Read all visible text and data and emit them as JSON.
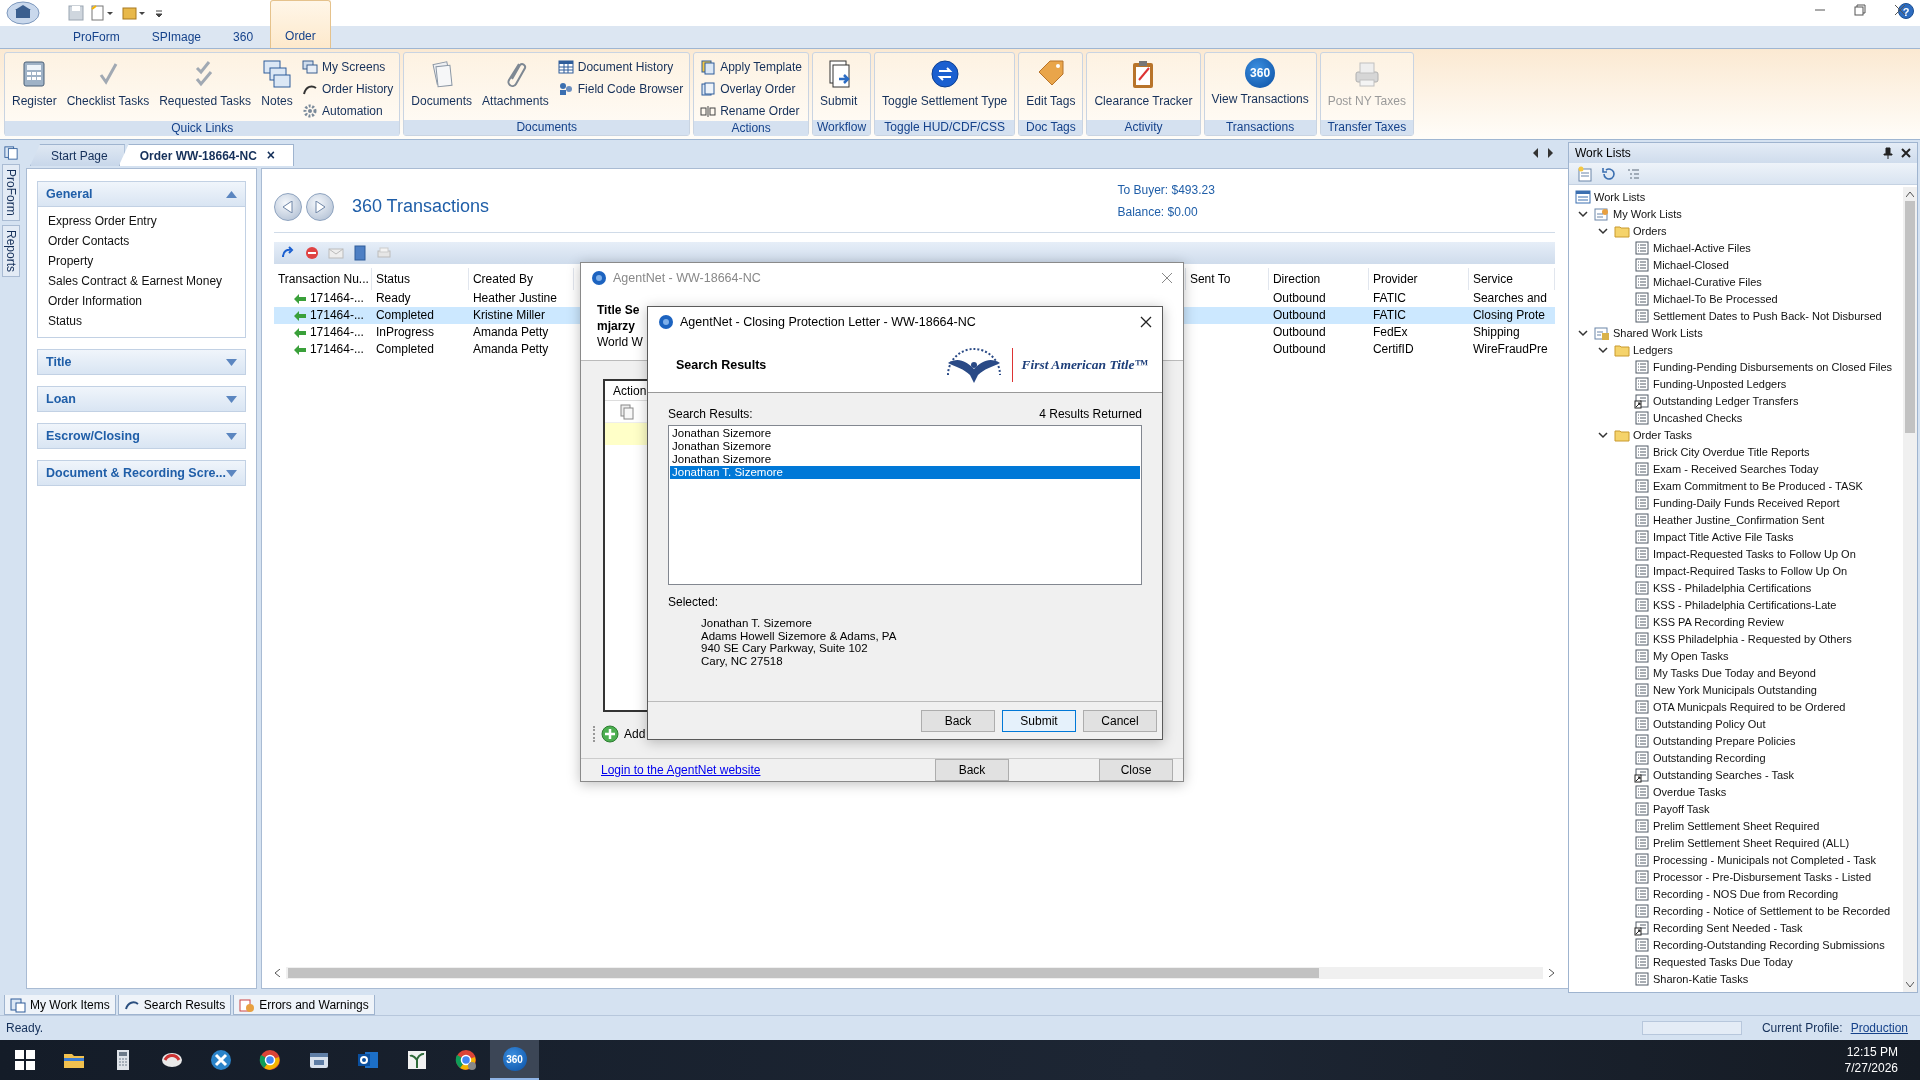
{
  "ribbon_tabs": [
    {
      "label": "ProForm",
      "selected": false
    },
    {
      "label": "SPImage",
      "selected": false
    },
    {
      "label": "360",
      "selected": false
    },
    {
      "label": "Order",
      "selected": true
    }
  ],
  "help": "?",
  "ribbon_groups": [
    {
      "label": "Quick Links",
      "buttons": [
        {
          "label": "Register",
          "kind": "large"
        },
        {
          "label": "Checklist Tasks",
          "kind": "large"
        },
        {
          "label": "Requested Tasks",
          "kind": "large"
        },
        {
          "label": "Notes",
          "kind": "large"
        },
        {
          "label": "My Screens",
          "kind": "small"
        },
        {
          "label": "Order History",
          "kind": "small"
        },
        {
          "label": "Automation",
          "kind": "small"
        }
      ]
    },
    {
      "label": "Documents",
      "buttons": [
        {
          "label": "Documents",
          "kind": "large"
        },
        {
          "label": "Attachments",
          "kind": "large"
        },
        {
          "label": "Document History",
          "kind": "small"
        },
        {
          "label": "Field Code Browser",
          "kind": "small"
        }
      ]
    },
    {
      "label": "Actions",
      "buttons": [
        {
          "label": "Apply Template",
          "kind": "small"
        },
        {
          "label": "Overlay Order",
          "kind": "small"
        },
        {
          "label": "Rename Order",
          "kind": "small"
        }
      ]
    },
    {
      "label": "Workflow",
      "buttons": [
        {
          "label": "Submit",
          "kind": "large"
        }
      ]
    },
    {
      "label": "Toggle HUD/CDF/CSS",
      "buttons": [
        {
          "label": "Toggle Settlement Type",
          "kind": "large"
        }
      ]
    },
    {
      "label": "Doc Tags",
      "buttons": [
        {
          "label": "Edit Tags",
          "kind": "large"
        }
      ]
    },
    {
      "label": "Activity",
      "buttons": [
        {
          "label": "Clearance Tracker",
          "kind": "large"
        }
      ]
    },
    {
      "label": "Transactions",
      "buttons": [
        {
          "label": "View Transactions",
          "kind": "large",
          "badge": "360"
        }
      ]
    },
    {
      "label": "Transfer Taxes",
      "buttons": [
        {
          "label": "Post NY Taxes",
          "kind": "large",
          "disabled": true
        }
      ]
    }
  ],
  "side_tabs": [
    "ProForm",
    "Reports"
  ],
  "document_tabs": [
    {
      "label": "Start Page",
      "selected": false
    },
    {
      "label": "Order WW-18664-NC",
      "selected": true,
      "close": "×"
    }
  ],
  "nav_sections": [
    {
      "title": "General",
      "expanded": true,
      "items": [
        "Express Order Entry",
        "Order Contacts",
        "Property",
        "Sales Contract & Earnest Money",
        "Order Information",
        "Status"
      ]
    },
    {
      "title": "Title",
      "expanded": false
    },
    {
      "title": "Loan",
      "expanded": false
    },
    {
      "title": "Escrow/Closing",
      "expanded": false
    },
    {
      "title": "Document & Recording Scre...",
      "expanded": false
    }
  ],
  "transactions": {
    "title": "360 Transactions",
    "to_buyer": "To Buyer: $493.23",
    "balance": "Balance: $0.00",
    "columns": [
      "Transaction Nu...",
      "Status",
      "Created By",
      "Sent To",
      "Direction",
      "Provider",
      "Service"
    ],
    "rows": [
      {
        "selected": false,
        "cells": [
          "171464-...",
          "Ready",
          "Heather Justine",
          "",
          "Outbound",
          "FATIC",
          "Searches and"
        ]
      },
      {
        "selected": true,
        "cells": [
          "171464-...",
          "Completed",
          "Kristine Miller",
          "",
          "Outbound",
          "FATIC",
          "Closing Prote"
        ]
      },
      {
        "selected": false,
        "cells": [
          "171464-...",
          "InProgress",
          "Amanda Petty",
          "",
          "Outbound",
          "FedEx",
          "Shipping"
        ]
      },
      {
        "selected": false,
        "cells": [
          "171464-...",
          "Completed",
          "Amanda Petty",
          "",
          "Outbound",
          "CertifID",
          "WireFraudPre"
        ]
      }
    ]
  },
  "agentnet_dialog": {
    "title": "AgentNet - WW-18664-NC",
    "header_lines": [
      "Title Se",
      "mjarzy",
      "World W"
    ],
    "table_header": "Action",
    "add_label": "Add",
    "link": "Login to the AgentNet website",
    "buttons": [
      "Back",
      "Close"
    ]
  },
  "cpl_dialog": {
    "title": "AgentNet - Closing Protection Letter - WW-18664-NC",
    "heading": "Search Results",
    "logo_text": "First American Title™",
    "results_label": "Search Results:",
    "results_count": "4 Results Returned",
    "results": [
      {
        "name": "Jonathan Sizemore",
        "selected": false
      },
      {
        "name": "Jonathan Sizemore",
        "selected": false
      },
      {
        "name": "Jonathan Sizemore",
        "selected": false
      },
      {
        "name": "Jonathan T. Sizemore",
        "selected": true
      }
    ],
    "selected_label": "Selected:",
    "selected_lines": [
      "Jonathan T. Sizemore",
      "Adams Howell Sizemore & Adams, PA",
      "940 SE Cary Parkway, Suite 102",
      "Cary, NC  27518"
    ],
    "buttons": [
      {
        "label": "Back",
        "default": false
      },
      {
        "label": "Submit",
        "default": true
      },
      {
        "label": "Cancel",
        "default": false
      }
    ]
  },
  "work_lists": {
    "title": "Work Lists",
    "tree": [
      {
        "label": "Work Lists",
        "kind": "root",
        "children": [
          {
            "label": "My Work Lists",
            "kind": "mine",
            "expanded": true,
            "children": [
              {
                "label": "Orders",
                "kind": "folder",
                "expanded": true,
                "children": [
                  {
                    "label": "Michael-Active Files",
                    "kind": "list"
                  },
                  {
                    "label": "Michael-Closed",
                    "kind": "list"
                  },
                  {
                    "label": "Michael-Curative Files",
                    "kind": "list"
                  },
                  {
                    "label": "Michael-To Be Processed",
                    "kind": "list"
                  },
                  {
                    "label": "Settlement Dates to Push Back- Not Disbursed",
                    "kind": "list"
                  }
                ]
              }
            ]
          },
          {
            "label": "Shared Work Lists",
            "kind": "shared",
            "expanded": true,
            "children": [
              {
                "label": "Ledgers",
                "kind": "folder",
                "expanded": true,
                "children": [
                  {
                    "label": "Funding-Pending Disbursements on Closed Files",
                    "kind": "list"
                  },
                  {
                    "label": "Funding-Unposted Ledgers",
                    "kind": "list"
                  },
                  {
                    "label": "Outstanding Ledger Transfers",
                    "kind": "link"
                  },
                  {
                    "label": "Uncashed Checks",
                    "kind": "list"
                  }
                ]
              },
              {
                "label": "Order Tasks",
                "kind": "folder",
                "expanded": true,
                "children": [
                  {
                    "label": "Brick City Overdue Title Reports",
                    "kind": "list"
                  },
                  {
                    "label": "Exam - Received Searches Today",
                    "kind": "list"
                  },
                  {
                    "label": "Exam Commitment to Be Produced - TASK",
                    "kind": "list"
                  },
                  {
                    "label": "Funding-Daily Funds Received Report",
                    "kind": "list"
                  },
                  {
                    "label": "Heather Justine_Confirmation Sent",
                    "kind": "list"
                  },
                  {
                    "label": "Impact Title Active File Tasks",
                    "kind": "list"
                  },
                  {
                    "label": "Impact-Requested Tasks to Follow Up On",
                    "kind": "list"
                  },
                  {
                    "label": "Impact-Required Tasks to Follow Up On",
                    "kind": "list"
                  },
                  {
                    "label": "KSS - Philadelphia Certifications",
                    "kind": "list"
                  },
                  {
                    "label": "KSS - Philadelphia Certifications-Late",
                    "kind": "list"
                  },
                  {
                    "label": "KSS PA Recording Review",
                    "kind": "list"
                  },
                  {
                    "label": "KSS Philadelphia - Requested by Others",
                    "kind": "list"
                  },
                  {
                    "label": "My Open Tasks",
                    "kind": "list"
                  },
                  {
                    "label": "My Tasks Due Today and Beyond",
                    "kind": "list"
                  },
                  {
                    "label": "New York Municipals Outstanding",
                    "kind": "list"
                  },
                  {
                    "label": "OTA Municpals Required to be Ordered",
                    "kind": "list"
                  },
                  {
                    "label": "Outstanding Policy Out",
                    "kind": "list"
                  },
                  {
                    "label": "Outstanding Prepare Policies",
                    "kind": "list"
                  },
                  {
                    "label": "Outstanding Recording",
                    "kind": "list"
                  },
                  {
                    "label": "Outstanding Searches - Task",
                    "kind": "link"
                  },
                  {
                    "label": "Overdue Tasks",
                    "kind": "list"
                  },
                  {
                    "label": "Payoff Task",
                    "kind": "list"
                  },
                  {
                    "label": "Prelim Settlement Sheet Required",
                    "kind": "list"
                  },
                  {
                    "label": "Prelim Settlement Sheet Required (ALL)",
                    "kind": "list"
                  },
                  {
                    "label": "Processing - Municipals not Completed - Task",
                    "kind": "list"
                  },
                  {
                    "label": "Processor - Pre-Disbursement Tasks - Listed",
                    "kind": "list"
                  },
                  {
                    "label": "Recording - NOS Due from Recording",
                    "kind": "list"
                  },
                  {
                    "label": "Recording - Notice of Settlement to be Recorded",
                    "kind": "list"
                  },
                  {
                    "label": "Recording Sent Needed - Task",
                    "kind": "link"
                  },
                  {
                    "label": "Recording-Outstanding Recording Submissions",
                    "kind": "list"
                  },
                  {
                    "label": "Requested Tasks Due Today",
                    "kind": "list"
                  },
                  {
                    "label": "Sharon-Katie Tasks",
                    "kind": "list"
                  }
                ]
              }
            ]
          }
        ]
      }
    ]
  },
  "bottom_tabs": [
    {
      "label": "My Work Items"
    },
    {
      "label": "Search Results"
    },
    {
      "label": "Errors and Warnings"
    }
  ],
  "status_bar": {
    "text": "Ready.",
    "profile_label": "Current Profile:",
    "profile": "Production"
  },
  "taskbar": {
    "apps": [
      {
        "selected": false
      },
      {
        "selected": false
      },
      {
        "selected": false
      },
      {
        "selected": false
      },
      {
        "selected": false
      },
      {
        "selected": false
      },
      {
        "selected": false
      },
      {
        "selected": false
      },
      {
        "selected": false
      },
      {
        "selected": false
      },
      {
        "selected": true,
        "badge": "360"
      }
    ],
    "time": "12:15 PM",
    "date": "7/27/2026"
  }
}
